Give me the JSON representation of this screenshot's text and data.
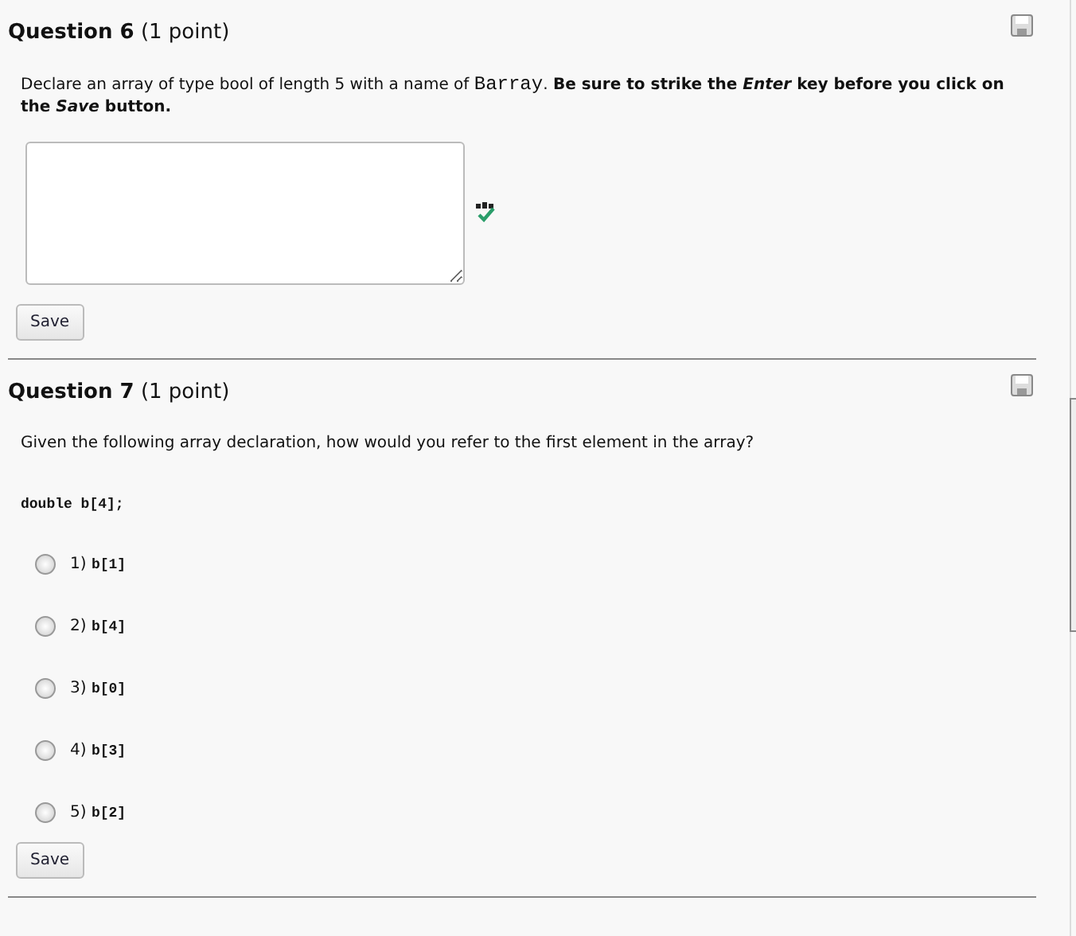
{
  "questions": [
    {
      "kind": "essay",
      "number": "Question 6",
      "points": "(1 point)",
      "prompt": [
        {
          "kind": "plain",
          "text": "Declare an array of type bool of length 5 with a name of "
        },
        {
          "kind": "code",
          "text": "Barray"
        },
        {
          "kind": "plain",
          "text": ". "
        },
        {
          "kind": "bold",
          "text": "Be sure to strike the *Enter* key before you click on the *Save* button."
        }
      ],
      "save_label": "Save"
    },
    {
      "kind": "choice",
      "number": "Question 7",
      "points": "(1 point)",
      "prompt": [
        {
          "kind": "plain",
          "text": "Given the following array declaration, how would you refer to the first element in the array?"
        }
      ],
      "code": "double b[4];",
      "options": [
        {
          "number": "1)",
          "text": "b[1]",
          "selected": false
        },
        {
          "number": "2)",
          "text": "b[4]",
          "selected": false
        },
        {
          "number": "3)",
          "text": "b[0]",
          "selected": false
        },
        {
          "number": "4)",
          "text": "b[3]",
          "selected": false
        },
        {
          "number": "5)",
          "text": "b[2]",
          "selected": false
        }
      ],
      "save_label": "Save"
    }
  ]
}
